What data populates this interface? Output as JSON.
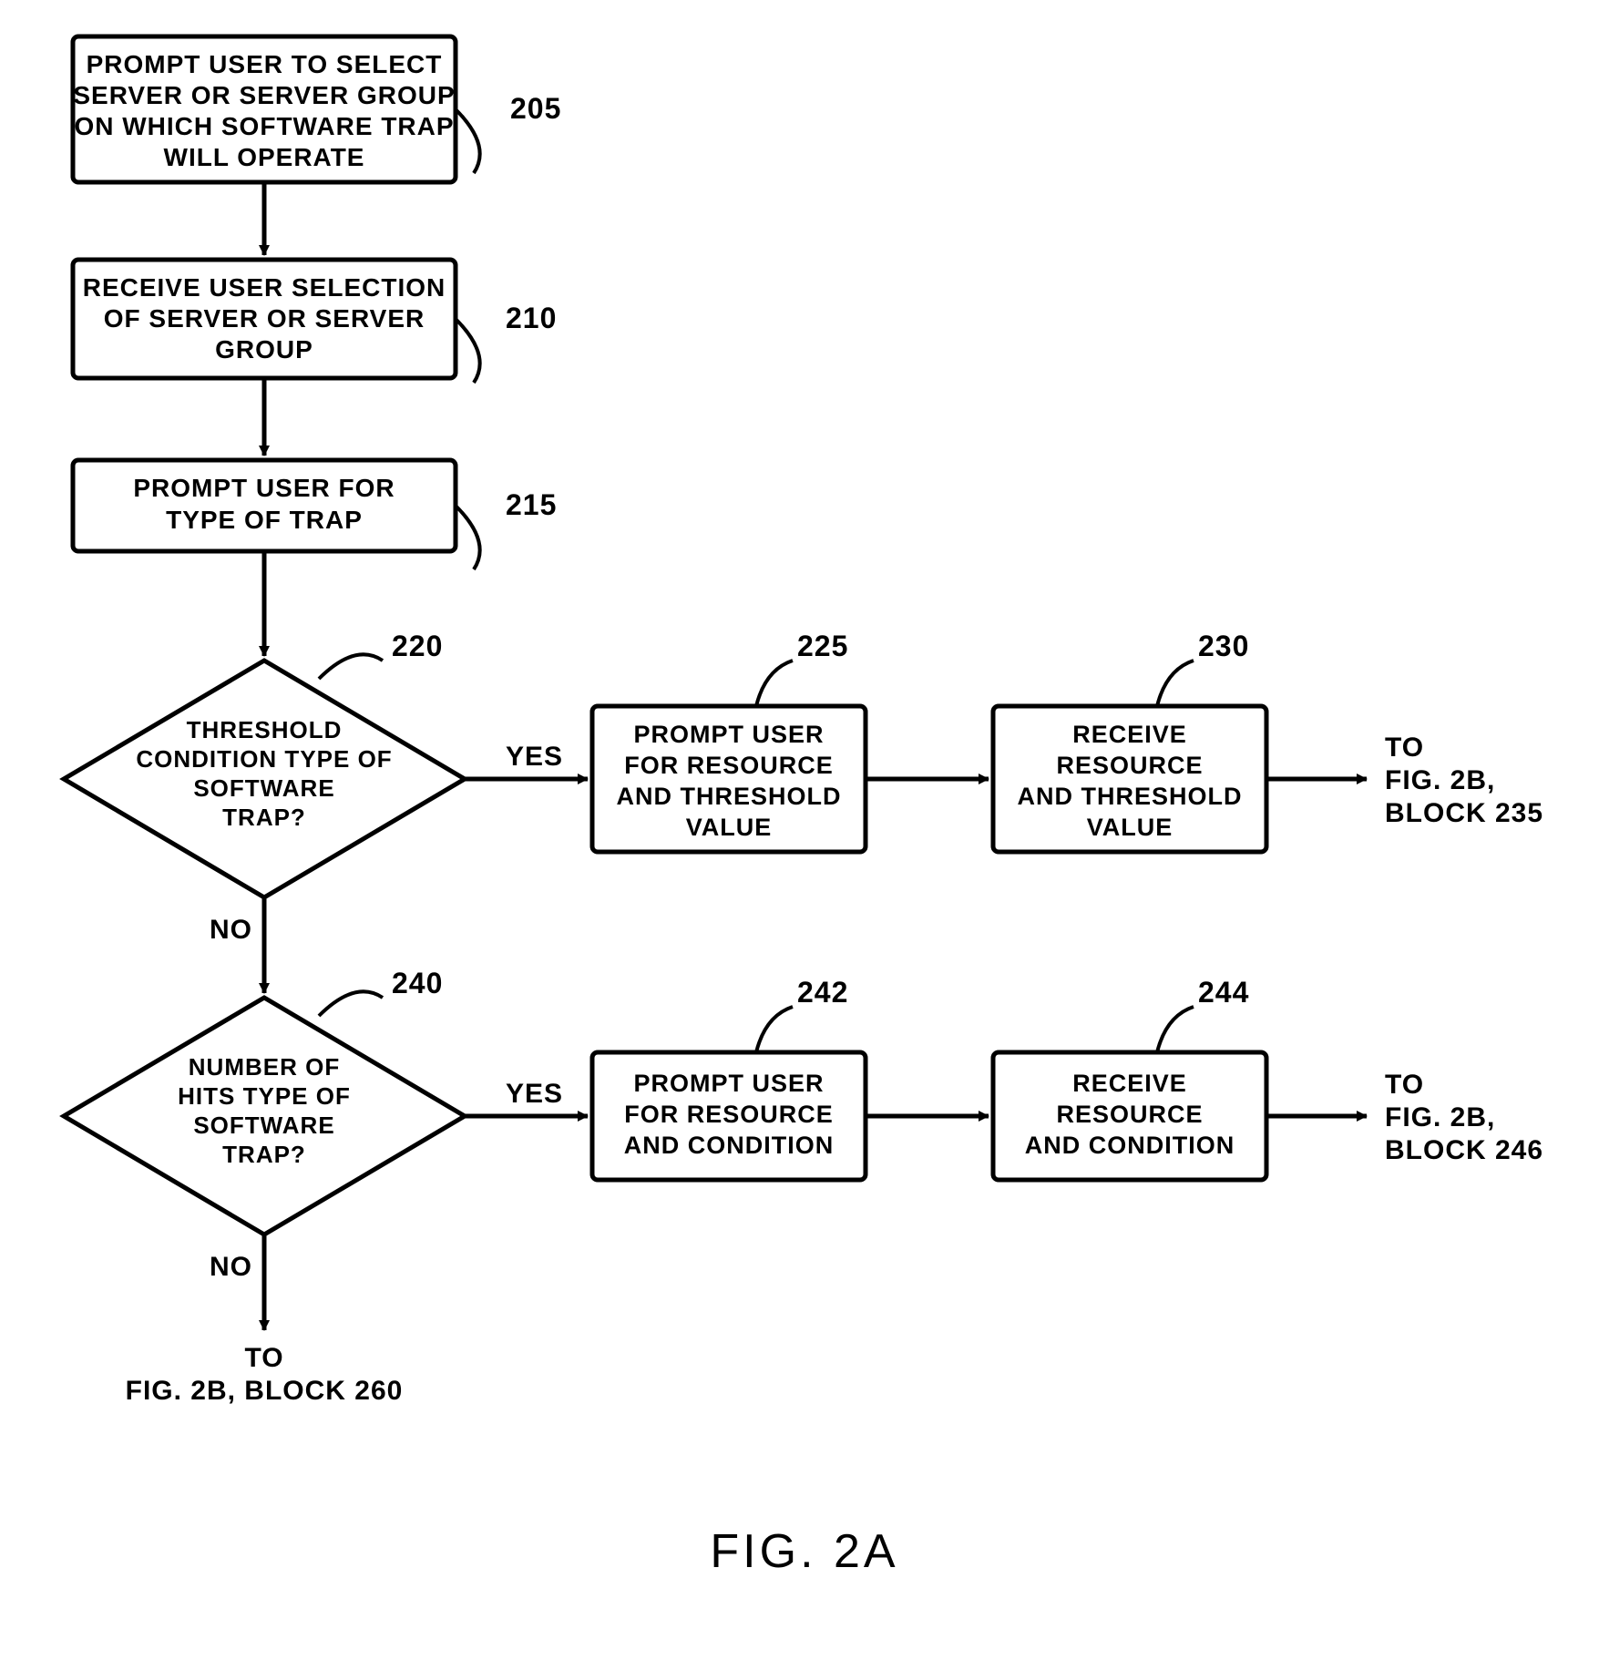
{
  "chart_data": {
    "type": "flowchart",
    "title": "FIG. 2A",
    "nodes": [
      {
        "id": "205",
        "shape": "process",
        "label": "PROMPT USER TO SELECT SERVER OR SERVER GROUP ON WHICH SOFTWARE TRAP WILL OPERATE"
      },
      {
        "id": "210",
        "shape": "process",
        "label": "RECEIVE USER SELECTION OF SERVER OR SERVER GROUP"
      },
      {
        "id": "215",
        "shape": "process",
        "label": "PROMPT USER FOR TYPE OF TRAP"
      },
      {
        "id": "220",
        "shape": "decision",
        "label": "THRESHOLD CONDITION TYPE OF SOFTWARE TRAP?"
      },
      {
        "id": "225",
        "shape": "process",
        "label": "PROMPT USER FOR RESOURCE AND THRESHOLD VALUE"
      },
      {
        "id": "230",
        "shape": "process",
        "label": "RECEIVE RESOURCE AND THRESHOLD VALUE"
      },
      {
        "id": "240",
        "shape": "decision",
        "label": "NUMBER OF HITS TYPE OF SOFTWARE TRAP?"
      },
      {
        "id": "242",
        "shape": "process",
        "label": "PROMPT USER FOR RESOURCE AND CONDITION"
      },
      {
        "id": "244",
        "shape": "process",
        "label": "RECEIVE RESOURCE AND CONDITION"
      }
    ],
    "edges": [
      {
        "from": "205",
        "to": "210"
      },
      {
        "from": "210",
        "to": "215"
      },
      {
        "from": "215",
        "to": "220"
      },
      {
        "from": "220",
        "to": "225",
        "label": "YES"
      },
      {
        "from": "225",
        "to": "230"
      },
      {
        "from": "230",
        "to": "offpage-235",
        "label": "TO FIG. 2B, BLOCK 235"
      },
      {
        "from": "220",
        "to": "240",
        "label": "NO"
      },
      {
        "from": "240",
        "to": "242",
        "label": "YES"
      },
      {
        "from": "242",
        "to": "244"
      },
      {
        "from": "244",
        "to": "offpage-246",
        "label": "TO FIG. 2B, BLOCK 246"
      },
      {
        "from": "240",
        "to": "offpage-260",
        "label": "NO / TO FIG. 2B, BLOCK 260"
      }
    ]
  },
  "labels": {
    "box205_l1": "PROMPT USER TO SELECT",
    "box205_l2": "SERVER OR SERVER GROUP",
    "box205_l3": "ON WHICH SOFTWARE TRAP",
    "box205_l4": "WILL OPERATE",
    "ref205": "205",
    "box210_l1": "RECEIVE USER SELECTION",
    "box210_l2": "OF SERVER OR SERVER",
    "box210_l3": "GROUP",
    "ref210": "210",
    "box215_l1": "PROMPT USER FOR",
    "box215_l2": "TYPE OF TRAP",
    "ref215": "215",
    "dec220_l1": "THRESHOLD",
    "dec220_l2": "CONDITION TYPE OF",
    "dec220_l3": "SOFTWARE",
    "dec220_l4": "TRAP?",
    "ref220": "220",
    "yes": "YES",
    "no": "NO",
    "box225_l1": "PROMPT USER",
    "box225_l2": "FOR RESOURCE",
    "box225_l3": "AND THRESHOLD",
    "box225_l4": "VALUE",
    "ref225": "225",
    "box230_l1": "RECEIVE",
    "box230_l2": "RESOURCE",
    "box230_l3": "AND THRESHOLD",
    "box230_l4": "VALUE",
    "ref230": "230",
    "off235_l1": "TO",
    "off235_l2": "FIG. 2B,",
    "off235_l3": "BLOCK 235",
    "dec240_l1": "NUMBER OF",
    "dec240_l2": "HITS TYPE OF",
    "dec240_l3": "SOFTWARE",
    "dec240_l4": "TRAP?",
    "ref240": "240",
    "box242_l1": "PROMPT USER",
    "box242_l2": "FOR RESOURCE",
    "box242_l3": "AND CONDITION",
    "ref242": "242",
    "box244_l1": "RECEIVE",
    "box244_l2": "RESOURCE",
    "box244_l3": "AND CONDITION",
    "ref244": "244",
    "off246_l1": "TO",
    "off246_l2": "FIG. 2B,",
    "off246_l3": "BLOCK 246",
    "off260_l1": "TO",
    "off260_l2": "FIG. 2B,  BLOCK 260",
    "figcaption": "FIG.  2A"
  }
}
